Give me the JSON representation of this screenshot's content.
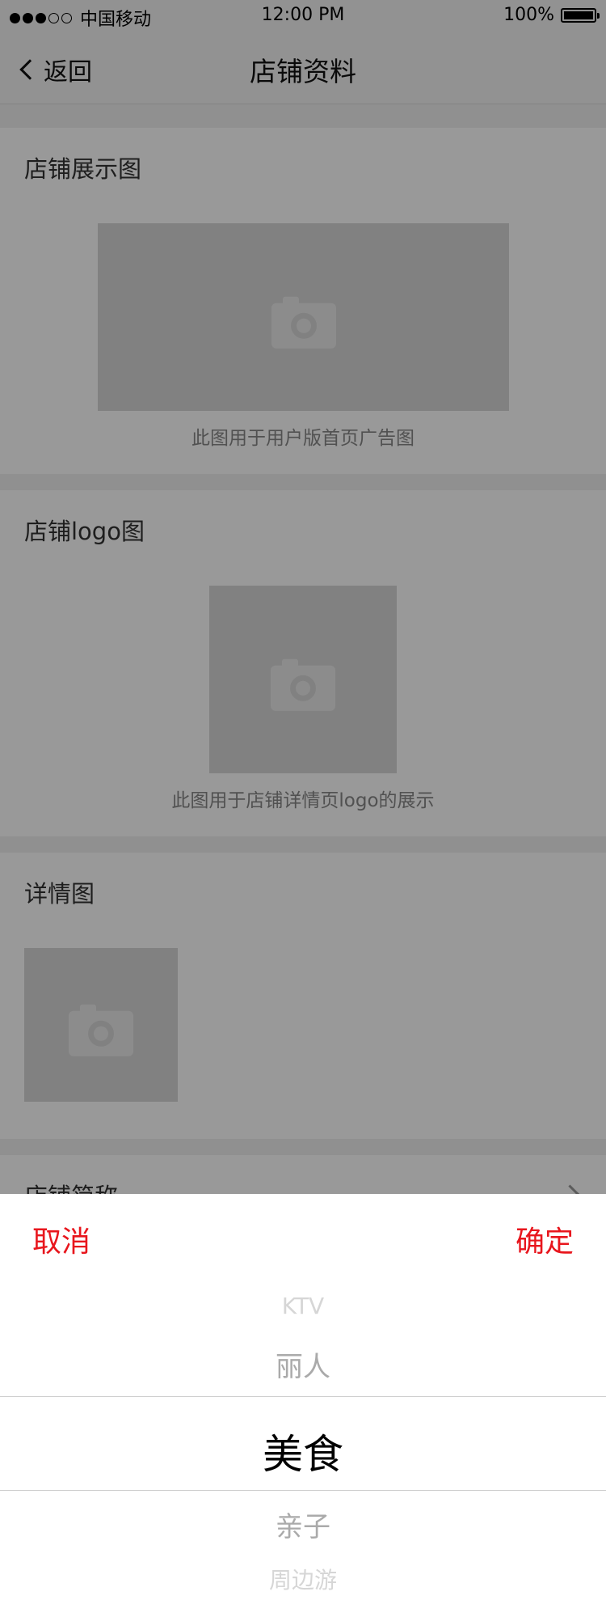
{
  "status_bar": {
    "carrier": "中国移动",
    "time": "12:00 PM",
    "battery_percent": "100%"
  },
  "nav": {
    "back_label": "返回",
    "title": "店铺资料"
  },
  "sections": {
    "display_image": {
      "title": "店铺展示图",
      "caption": "此图用于用户版首页广告图"
    },
    "logo_image": {
      "title": "店铺logo图",
      "caption": "此图用于店铺详情页logo的展示"
    },
    "detail_image": {
      "title": "详情图"
    },
    "short_name": {
      "title": "店铺简称"
    }
  },
  "picker": {
    "cancel_label": "取消",
    "confirm_label": "确定",
    "options": [
      "KTV",
      "丽人",
      "美食",
      "亲子",
      "周边游"
    ],
    "selected": "美食"
  },
  "colors": {
    "accent": "#e8161d",
    "overlay": "rgba(0,0,0,0.4)"
  }
}
